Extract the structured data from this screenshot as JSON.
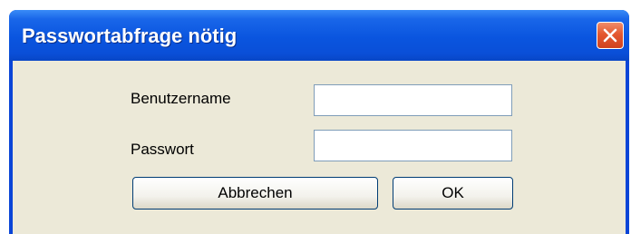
{
  "dialog": {
    "title": "Passwortabfrage nötig",
    "close_icon": "close-icon"
  },
  "form": {
    "username_label": "Benutzername",
    "username_value": "",
    "password_label": "Passwort",
    "password_value": ""
  },
  "buttons": {
    "cancel_label": "Abbrechen",
    "ok_label": "OK"
  },
  "colors": {
    "titlebar": "#0a55df",
    "client": "#ece9d8",
    "close": "#e4582f"
  }
}
